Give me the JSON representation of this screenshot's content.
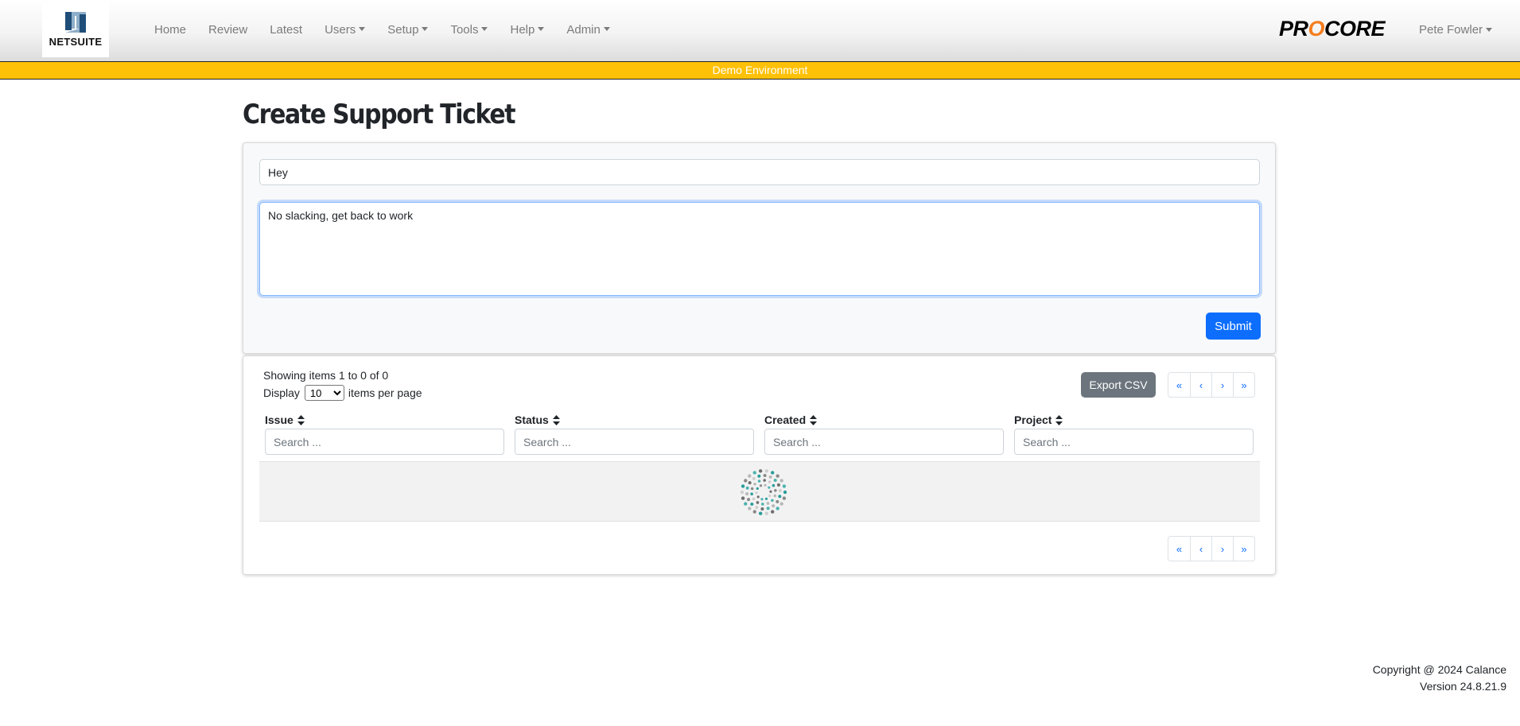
{
  "navbar": {
    "logo_text": "NETSUITE",
    "items": [
      {
        "label": "Home",
        "dropdown": false
      },
      {
        "label": "Review",
        "dropdown": false
      },
      {
        "label": "Latest",
        "dropdown": false
      },
      {
        "label": "Users",
        "dropdown": true
      },
      {
        "label": "Setup",
        "dropdown": true
      },
      {
        "label": "Tools",
        "dropdown": true
      },
      {
        "label": "Help",
        "dropdown": true
      },
      {
        "label": "Admin",
        "dropdown": true
      }
    ],
    "brand_right": {
      "part1": "PR",
      "part2": "O",
      "part3": "CORE",
      "accent_color": "#f47e20"
    },
    "user_name": "Pete Fowler"
  },
  "banner": {
    "text": "Demo Environment",
    "color": "#ffc107"
  },
  "page": {
    "title": "Create Support Ticket"
  },
  "form": {
    "subject_value": "Hey",
    "message_value": "No slacking, get back to work",
    "submit_label": "Submit"
  },
  "table": {
    "showing_text": "Showing items 1 to 0 of 0",
    "display_label": "Display",
    "per_page_value": "10",
    "per_page_suffix": "items per page",
    "export_label": "Export CSV",
    "pager": [
      "«",
      "‹",
      "›",
      "»"
    ],
    "columns": [
      {
        "label": "Issue",
        "placeholder": "Search ..."
      },
      {
        "label": "Status",
        "placeholder": "Search ..."
      },
      {
        "label": "Created",
        "placeholder": "Search ..."
      },
      {
        "label": "Project",
        "placeholder": "Search ..."
      }
    ],
    "loading": true
  },
  "footer": {
    "copyright": "Copyright @ 2024 Calance",
    "version": "Version 24.8.21.9"
  },
  "colors": {
    "primary": "#0d6efd",
    "secondary": "#6c757d"
  }
}
